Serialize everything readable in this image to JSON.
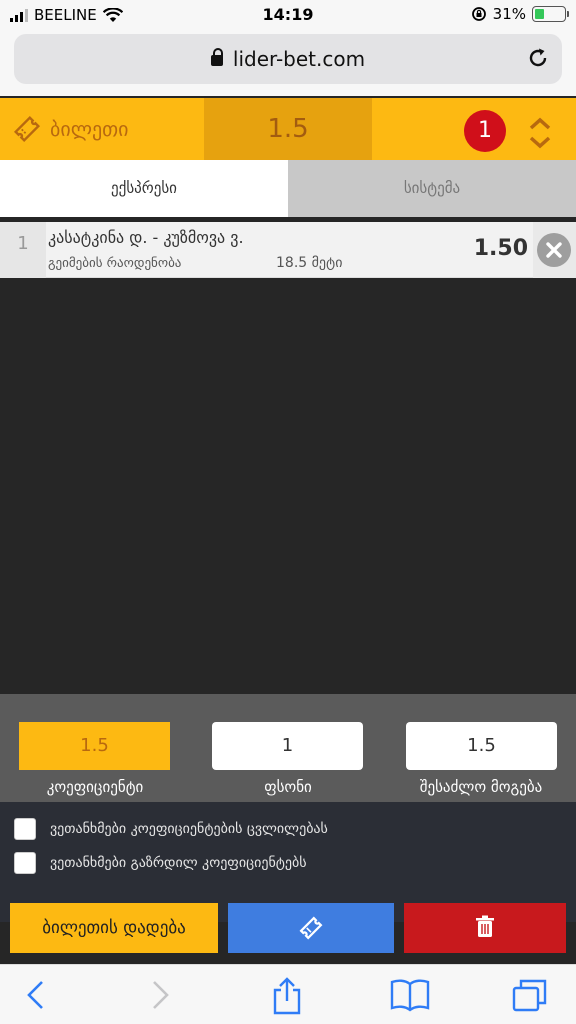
{
  "status_bar": {
    "carrier": "BEELINE",
    "time": "14:19",
    "battery_percent": "31%",
    "battery_level": 0.31
  },
  "browser": {
    "url": "lider-bet.com"
  },
  "ticket": {
    "label": "ბილეთი",
    "total_odds": "1.5",
    "count": "1"
  },
  "tabs": [
    {
      "label": "ექსპრესი",
      "active": true
    },
    {
      "label": "სისტემა",
      "active": false
    }
  ],
  "bets": [
    {
      "index": "1",
      "match": "კასატკინა დ. - კუზმოვა ვ.",
      "market": "გეიმების რაოდენობა",
      "selection": "18.5 მეტი",
      "odds": "1.50"
    }
  ],
  "summary": {
    "coefficient": {
      "value": "1.5",
      "label": "კოეფიციენტი"
    },
    "stake": {
      "value": "1",
      "label": "ფსონი"
    },
    "possible_win": {
      "value": "1.5",
      "label": "შესაძლო მოგება"
    }
  },
  "options": [
    {
      "label": "ვეთანხმები კოეფიციენტების ცვლილებას",
      "checked": false
    },
    {
      "label": "ვეთანხმები გაზრდილ კოეფიციენტებს",
      "checked": false
    }
  ],
  "actions": {
    "place_bet": "ბილეთის დადება"
  },
  "colors": {
    "brand_yellow": "#fdb912",
    "action_blue": "#3f7de0",
    "action_red": "#c8191d",
    "badge_red": "#d00f1a"
  }
}
